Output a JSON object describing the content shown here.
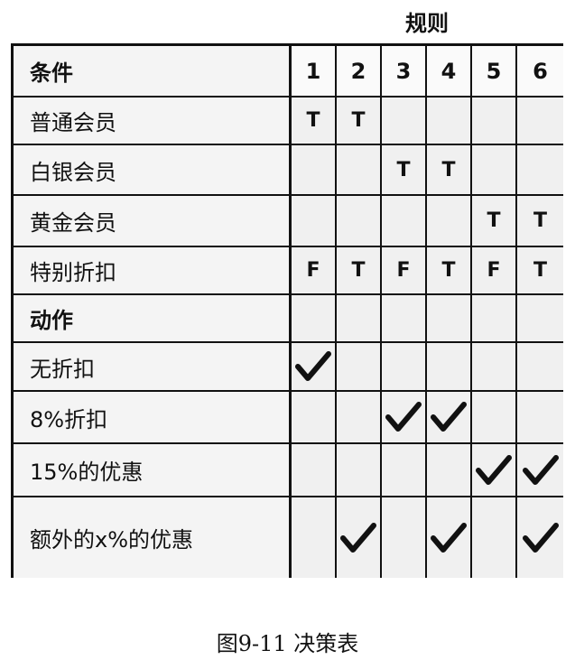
{
  "header": {
    "rules_label": "规则"
  },
  "table": {
    "columns": [
      "1",
      "2",
      "3",
      "4",
      "5",
      "6"
    ],
    "conditions_header": "条件",
    "actions_header": "动作",
    "conditions": [
      {
        "label": "普通会员",
        "values": [
          "T",
          "T",
          "",
          "",
          "",
          ""
        ]
      },
      {
        "label": "白银会员",
        "values": [
          "",
          "",
          "T",
          "T",
          "",
          ""
        ]
      },
      {
        "label": "黄金会员",
        "values": [
          "",
          "",
          "",
          "",
          "T",
          "T"
        ]
      },
      {
        "label": "特别折扣",
        "values": [
          "F",
          "T",
          "F",
          "T",
          "F",
          "T"
        ]
      }
    ],
    "actions": [
      {
        "label": "无折扣",
        "checks": [
          true,
          false,
          false,
          false,
          false,
          false
        ]
      },
      {
        "label": "8%折扣",
        "checks": [
          false,
          false,
          true,
          true,
          false,
          false
        ]
      },
      {
        "label": "15%的优惠",
        "checks": [
          false,
          false,
          false,
          false,
          true,
          true
        ]
      },
      {
        "label": "额外的x%的优惠",
        "checks": [
          false,
          true,
          false,
          true,
          false,
          true
        ]
      }
    ]
  },
  "caption": "图9-11 决策表"
}
